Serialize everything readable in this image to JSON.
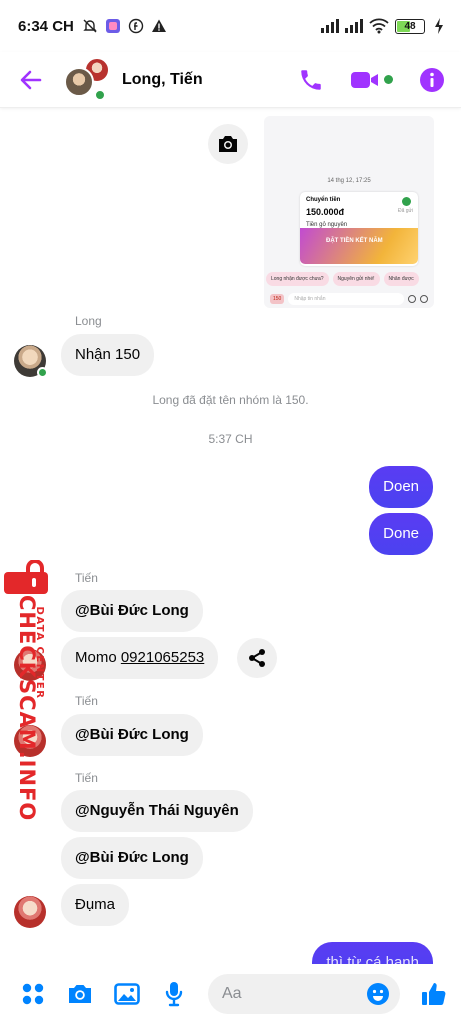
{
  "status_bar": {
    "time": "6:34 CH",
    "battery": "48"
  },
  "header": {
    "title": "Long, Tiến"
  },
  "chat": {
    "shared_image": {
      "date": "14 thg 12, 17:25",
      "card_title": "Chuyển tiền",
      "card_amount": "150.000đ",
      "card_status": "Đã gửi",
      "card_note": "Tiền gỏ nguyên",
      "banner_text": "ĐẶT TIỀN KẾT NĂM",
      "chips": [
        "Long nhận được chưa?",
        "Nguyên gửi nhé!",
        "Nhân được"
      ],
      "input_tag": "150",
      "input_placeholder": "Nhập tin nhắn"
    },
    "long_sender": "Long",
    "long_msg": "Nhận 150",
    "system_rename": "Long đã đặt tên nhóm là 150.",
    "time_divider": "5:37 CH",
    "out_msg_1": "Doen",
    "out_msg_2": "Done",
    "tien_sender_1": "Tiến",
    "tien_msg_1": "@Bùi Đức Long",
    "tien_msg_2_prefix": "Momo ",
    "tien_msg_2_phone": "0921065253",
    "tien_sender_2": "Tiến",
    "tien_msg_3": "@Bùi Đức Long",
    "tien_sender_3": "Tiến",
    "tien_msg_4": "@Nguyễn Thái Nguyên",
    "tien_msg_5": "@Bùi Đức Long",
    "tien_msg_6": "Đụma",
    "out_msg_3_partial": "thì từ cá hanh"
  },
  "watermark": {
    "main": "CHECKSCAM.INFO",
    "sub": "DATA CENTER"
  },
  "composer": {
    "placeholder": "Aa"
  },
  "colors": {
    "accent": "#a033ff",
    "outgoing": "#4b42f0",
    "online": "#31a24c",
    "watermark": "#e3282a"
  }
}
